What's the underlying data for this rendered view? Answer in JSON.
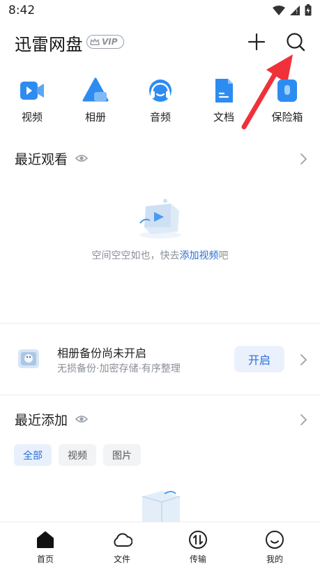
{
  "status_bar": {
    "time": "8:42"
  },
  "header": {
    "title": "迅雷网盘",
    "vip_label": "VIP"
  },
  "quick_access": [
    {
      "label": "视频",
      "icon": "video-icon"
    },
    {
      "label": "相册",
      "icon": "album-icon"
    },
    {
      "label": "音频",
      "icon": "audio-icon"
    },
    {
      "label": "文档",
      "icon": "document-icon"
    },
    {
      "label": "保险箱",
      "icon": "safe-icon"
    }
  ],
  "recent_watch": {
    "title": "最近观看",
    "empty_prefix": "空间空空如也，快去",
    "empty_link": "添加视频",
    "empty_suffix": "吧"
  },
  "backup": {
    "title": "相册备份尚未开启",
    "subtitle": "无损备份·加密存储·有序整理",
    "button": "开启"
  },
  "recent_add": {
    "title": "最近添加",
    "filters": [
      "全部",
      "视频",
      "图片"
    ],
    "active_filter": "全部"
  },
  "tabbar": [
    {
      "label": "首页",
      "icon": "home-icon"
    },
    {
      "label": "文件",
      "icon": "cloud-icon"
    },
    {
      "label": "传输",
      "icon": "transfer-icon"
    },
    {
      "label": "我的",
      "icon": "smile-icon"
    }
  ],
  "colors": {
    "accent": "#2a6fd6",
    "icon_blue": "#2e8cf0",
    "arrow_red": "#f0313a"
  }
}
